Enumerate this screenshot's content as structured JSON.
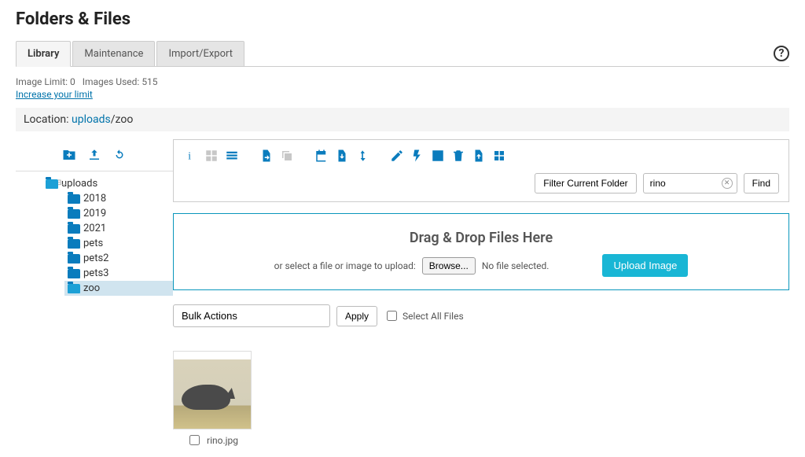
{
  "title": "Folders & Files",
  "tabs": [
    {
      "label": "Library",
      "active": true
    },
    {
      "label": "Maintenance",
      "active": false
    },
    {
      "label": "Import/Export",
      "active": false
    }
  ],
  "limits": {
    "image_limit_label": "Image Limit:",
    "image_limit_value": "0",
    "images_used_label": "Images Used:",
    "images_used_value": "515",
    "increase_link": "Increase your limit"
  },
  "location": {
    "label": "Location:",
    "link": "uploads",
    "current": "/zoo"
  },
  "tree": {
    "root": "uploads",
    "children": [
      {
        "name": "2018"
      },
      {
        "name": "2019"
      },
      {
        "name": "2021"
      },
      {
        "name": "pets"
      },
      {
        "name": "pets2"
      },
      {
        "name": "pets3"
      },
      {
        "name": "zoo",
        "selected": true
      }
    ]
  },
  "toolbar": {
    "filter_button": "Filter Current Folder",
    "search_value": "rino",
    "find_button": "Find"
  },
  "dropzone": {
    "heading": "Drag & Drop Files Here",
    "or_text": "or select a file or image to upload:",
    "browse_label": "Browse...",
    "no_file": "No file selected.",
    "upload_button": "Upload Image"
  },
  "bulk": {
    "select_label": "Bulk Actions",
    "apply_label": "Apply",
    "select_all_label": "Select All Files"
  },
  "files": [
    {
      "name": "rino.jpg"
    }
  ]
}
